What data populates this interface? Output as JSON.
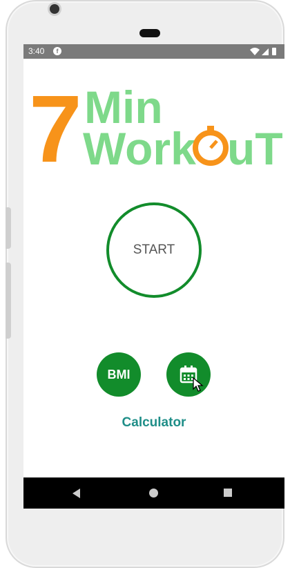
{
  "status_bar": {
    "time": "3:40",
    "notification_icon": "f-icon",
    "icons": [
      "wifi-icon",
      "cellular-signal-icon",
      "battery-icon"
    ]
  },
  "logo": {
    "number": "7",
    "line1": "Min",
    "line2_before": "Work",
    "line2_after": "uT",
    "stopwatch_icon": "stopwatch-icon"
  },
  "start_button": {
    "label": "START"
  },
  "bmi_button": {
    "label": "BMI"
  },
  "calendar_button": {
    "icon": "calendar-icon"
  },
  "calculator_label": "Calculator",
  "nav_bar": {
    "icons": [
      "back-icon",
      "home-icon",
      "recents-icon"
    ]
  },
  "colors": {
    "accent_green": "#128c2b",
    "logo_green": "#7ed98a",
    "logo_orange": "#f7931a",
    "label_teal": "#1f8e88",
    "status_bar": "#7a7a7a"
  }
}
